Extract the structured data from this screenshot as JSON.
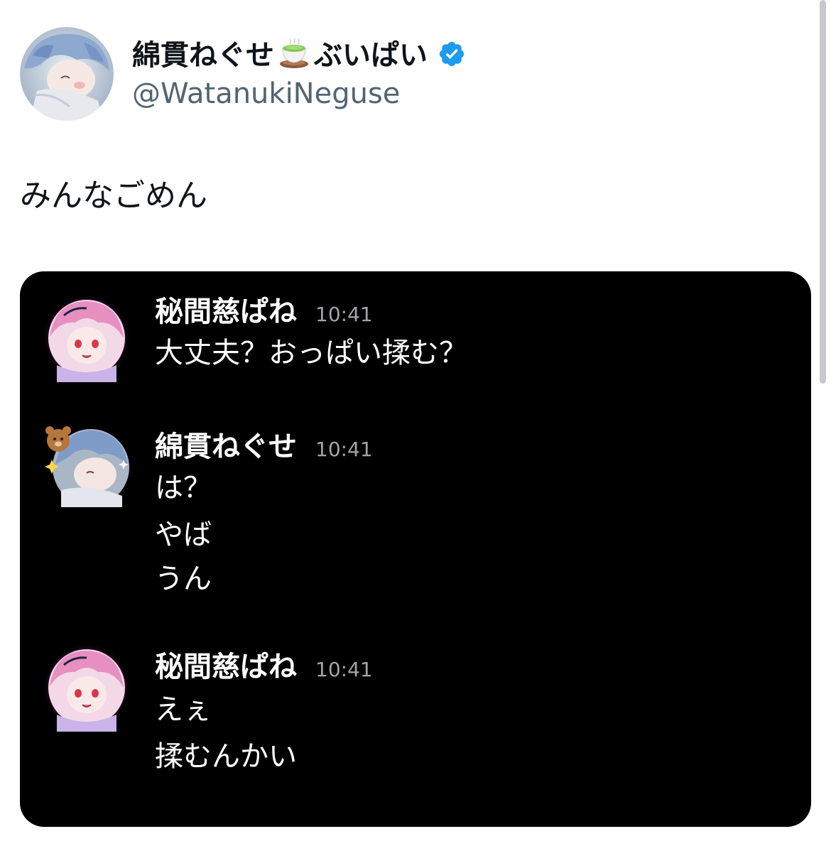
{
  "tweet": {
    "author": {
      "display_name": "綿貫ねぐせ",
      "display_suffix": "ぶいぱい",
      "name_emoji": "teacup-icon",
      "handle": "@WatanukiNeguse",
      "verified": true,
      "verified_color": "#1d9bf0"
    },
    "text": "みんなごめん"
  },
  "chat": {
    "background": "#000000",
    "groups": [
      {
        "author": "秘間慈ぱね",
        "time": "10:41",
        "lines": [
          "大丈夫？おっぱい揉む？"
        ]
      },
      {
        "author": "綿貫ねぐせ",
        "time": "10:41",
        "lines": [
          "は？",
          "やば",
          "うん"
        ]
      },
      {
        "author": "秘間慈ぱね",
        "time": "10:41",
        "lines": [
          "えぇ",
          "揉むんかい"
        ]
      }
    ]
  }
}
